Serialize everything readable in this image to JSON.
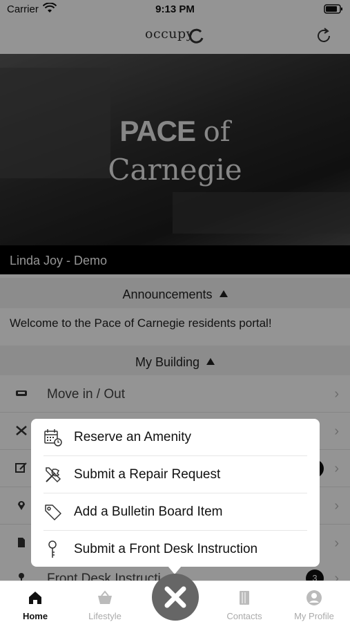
{
  "status": {
    "carrier": "Carrier",
    "time": "9:13 PM"
  },
  "header": {
    "logo_text": "occupy",
    "refresh_icon": "refresh-icon"
  },
  "hero": {
    "title_bold": "PACE",
    "title_of": "of",
    "title_line2": "Carnegie"
  },
  "user": {
    "name": "Linda Joy - Demo"
  },
  "announcements": {
    "heading": "Announcements",
    "message": "Welcome to the Pace of Carnegie residents portal!"
  },
  "building": {
    "heading": "My Building",
    "items": [
      {
        "label": "Move in / Out",
        "icon": "sofa-icon"
      },
      {
        "label": "",
        "icon": "tools-icon"
      },
      {
        "label": "",
        "icon": "edit-icon",
        "badge": ""
      },
      {
        "label": "",
        "icon": "location-pin-icon"
      },
      {
        "label": "",
        "icon": "document-icon"
      },
      {
        "label": "Front Desk Instructi",
        "icon": "key-icon",
        "badge": "3"
      }
    ]
  },
  "popup": {
    "items": [
      {
        "label": "Reserve an Amenity",
        "icon": "calendar-clock-icon"
      },
      {
        "label": "Submit a Repair Request",
        "icon": "tools-icon"
      },
      {
        "label": "Add a Bulletin Board Item",
        "icon": "tag-icon"
      },
      {
        "label": "Submit a Front Desk Instruction",
        "icon": "key-icon"
      }
    ]
  },
  "tabs": [
    {
      "label": "Home",
      "icon": "home-icon",
      "active": true
    },
    {
      "label": "Lifestyle",
      "icon": "basket-icon",
      "active": false
    },
    {
      "label": "Contacts",
      "icon": "contacts-book-icon",
      "active": false
    },
    {
      "label": "My Profile",
      "icon": "profile-icon",
      "active": false
    }
  ],
  "colors": {
    "fab": "#666666",
    "overlay": "rgba(0,0,0,0.42)",
    "name_bar": "#000000"
  }
}
